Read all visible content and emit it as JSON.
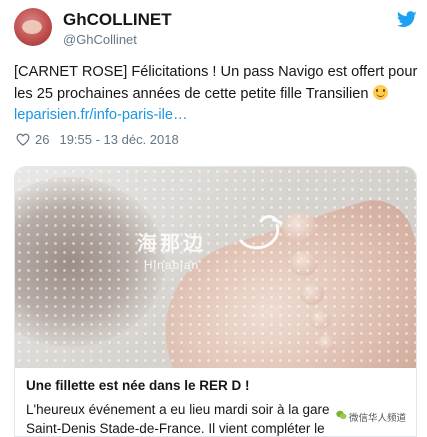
{
  "tweet": {
    "display_name": "GhCOLLINET",
    "handle": "@GhCollinet",
    "text_main": "[CARNET ROSE] Félicitations ! Un pass Navigo est offert pour les 25 prochaines années de cette petite fille Transilien ",
    "emoji": "slightly-smiling-face-icon",
    "link": "leparisien.fr/info-paris-ile…",
    "likes": "26",
    "timestamp": "19:55 - 13 déc. 2018"
  },
  "card": {
    "watermark_cn": "海那边",
    "watermark_en": "Hinabian",
    "title": "Une fillette est née dans le RER D !",
    "description": "L'heureux événement a eu lieu mardi soir à la gare Saint-Denis Stade-de-France. Il vient compléter le carnet de"
  },
  "overlay": {
    "wechat_label": "微信华人频道"
  },
  "colors": {
    "accent": "#1b95e0",
    "text": "#14171a",
    "muted": "#657786",
    "border": "#e1e8ed"
  }
}
